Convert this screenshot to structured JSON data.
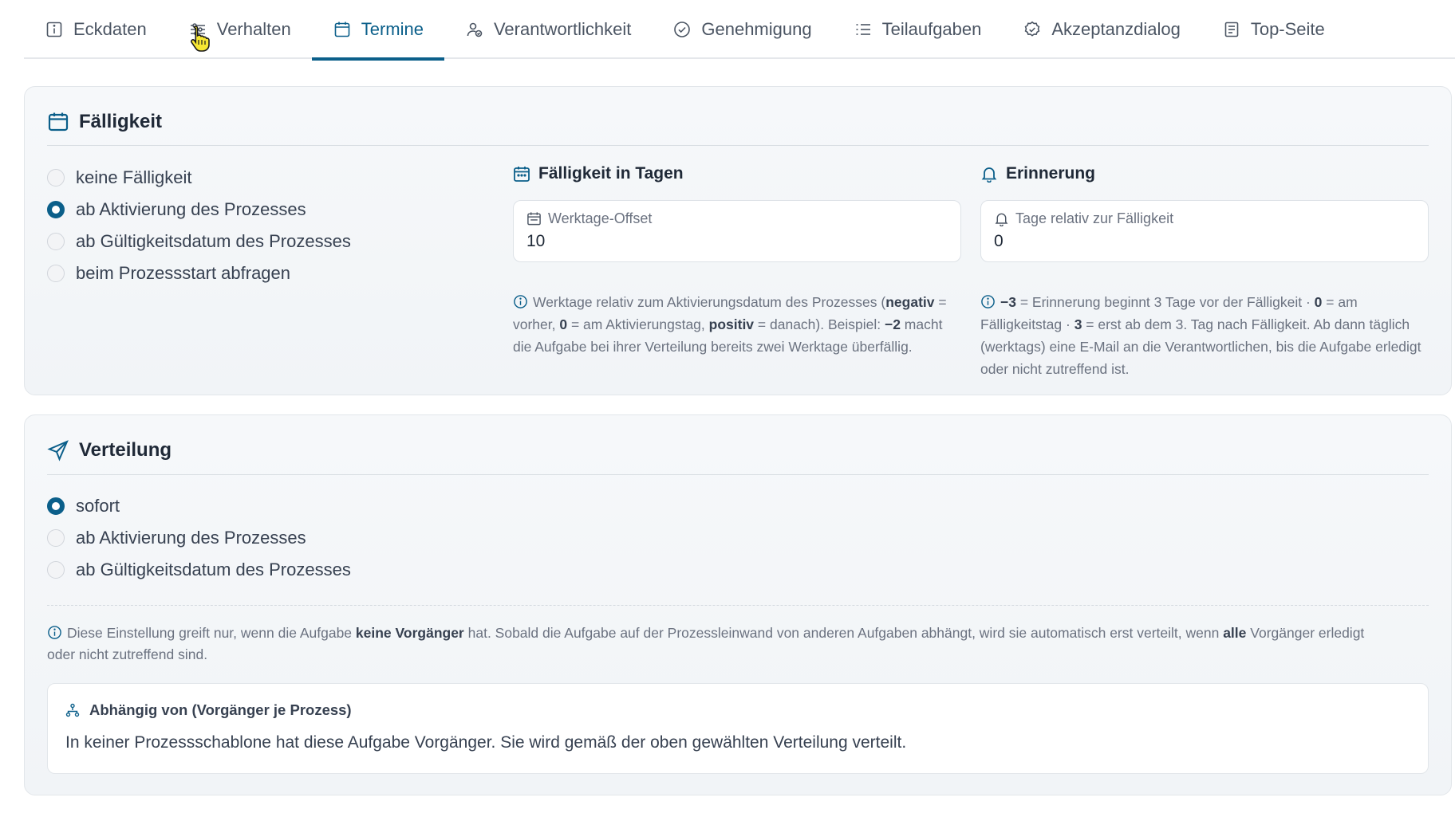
{
  "tabs": [
    {
      "label": "Eckdaten",
      "icon": "info-square-icon",
      "active": false
    },
    {
      "label": "Verhalten",
      "icon": "sliders-icon",
      "active": false
    },
    {
      "label": "Termine",
      "icon": "calendar-icon",
      "active": true
    },
    {
      "label": "Verantwortlichkeit",
      "icon": "user-check-icon",
      "active": false
    },
    {
      "label": "Genehmigung",
      "icon": "check-circle-icon",
      "active": false
    },
    {
      "label": "Teilaufgaben",
      "icon": "list-icon",
      "active": false
    },
    {
      "label": "Akzeptanzdialog",
      "icon": "badge-check-icon",
      "active": false
    },
    {
      "label": "Top-Seite",
      "icon": "document-icon",
      "active": false
    }
  ],
  "faelligkeit": {
    "title": "Fälligkeit",
    "options": [
      {
        "label": "keine Fälligkeit",
        "checked": false
      },
      {
        "label": "ab Aktivierung des Prozesses",
        "checked": true
      },
      {
        "label": "ab Gültigkeitsdatum des Prozesses",
        "checked": false
      },
      {
        "label": "beim Prozessstart abfragen",
        "checked": false
      }
    ],
    "days": {
      "title": "Fälligkeit in Tagen",
      "field_label": "Werktage-Offset",
      "value": "10",
      "hint_1": "Werktage relativ zum Aktivierungsdatum des Prozesses (",
      "hint_b1": "negativ",
      "hint_2": " = vorher, ",
      "hint_b2": "0",
      "hint_3": " = am Aktivierungstag, ",
      "hint_b3": "positiv",
      "hint_4": " = danach). Beispiel: ",
      "hint_b4": "−2",
      "hint_5": " macht die Aufgabe bei ihrer Verteilung bereits zwei Werktage überfällig."
    },
    "reminder": {
      "title": "Erinnerung",
      "field_label": "Tage relativ zur Fälligkeit",
      "value": "0",
      "hint_b1": "−3",
      "hint_1": " = Erinnerung beginnt 3 Tage vor der Fälligkeit · ",
      "hint_b2": "0",
      "hint_2": " = am Fälligkeitstag · ",
      "hint_b3": "3",
      "hint_3": " = erst ab dem 3. Tag nach Fälligkeit. Ab dann täglich (werktags) eine E-Mail an die Verantwortlichen, bis die Aufgabe erledigt oder nicht zutreffend ist."
    }
  },
  "verteilung": {
    "title": "Verteilung",
    "options": [
      {
        "label": "sofort",
        "checked": true
      },
      {
        "label": "ab Aktivierung des Prozesses",
        "checked": false
      },
      {
        "label": "ab Gültigkeitsdatum des Prozesses",
        "checked": false
      }
    ],
    "note_1": "Diese Einstellung greift nur, wenn die Aufgabe ",
    "note_b1": "keine Vorgänger",
    "note_2": " hat. Sobald die Aufgabe auf der Prozessleinwand von anderen Aufgaben abhängt, wird sie automatisch erst verteilt, wenn ",
    "note_b2": "alle",
    "note_3": " Vorgänger erledigt oder nicht zutreffend sind.",
    "dependency": {
      "title": "Abhängig von (Vorgänger je Prozess)",
      "text": "In keiner Prozessschablone hat diese Aufgabe Vorgänger. Sie wird gemäß der oben gewählten Verteilung verteilt."
    }
  },
  "colors": {
    "accent": "#0b5f8a",
    "text": "#1f2937",
    "muted": "#6b7280"
  }
}
